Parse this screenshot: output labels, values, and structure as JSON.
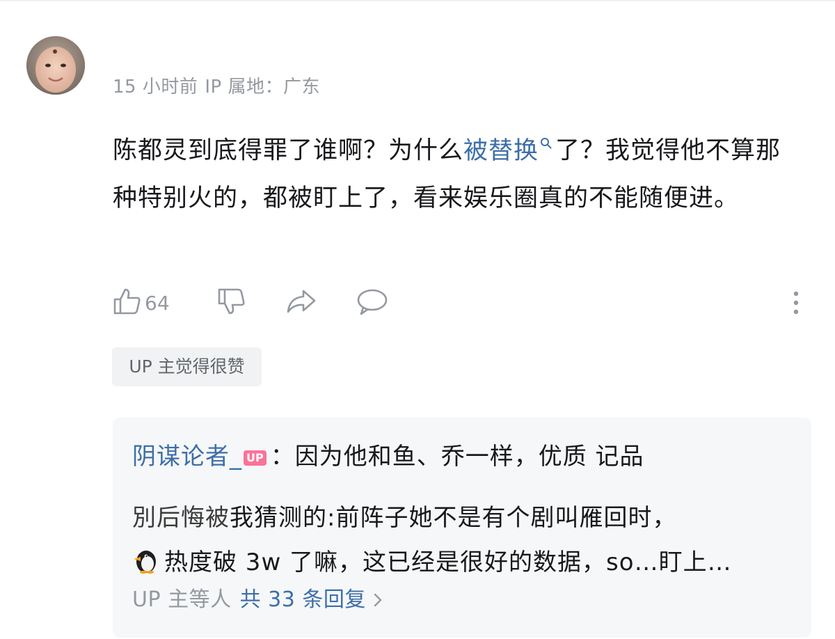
{
  "comment": {
    "time": "15 小时前",
    "ip_location": "IP 属地：广东",
    "text_before": "陈都灵到底得罪了谁啊？为什么",
    "keyword": "被替换",
    "text_after": "了？我觉得他不算那种特别火的，都被盯上了，看来娱乐圈真的不能随便进。",
    "like_count": "64",
    "up_liked_tag": "UP 主觉得很赞"
  },
  "reply_preview": {
    "author": "阴谋论者_",
    "author_badge": "UP",
    "text": "：因为他和鱼、乔一样，优质 记品",
    "line2_garbled": "別后悔被",
    "line2_rest": "我猜测的:前阵子她不是有个剧叫雁回时，",
    "line3_rest": "热度破 3w 了嘛，这已经是很好的数据，so…盯上…",
    "footer_who": "UP 主等人",
    "footer_count": "共 33 条回复"
  },
  "colors": {
    "link_blue": "#3d6fa8",
    "meta_gray": "#9499a0",
    "up_pink": "#fb7299",
    "reply_bg": "#f6f7f8",
    "tag_bg": "#f1f2f3"
  },
  "icons": {
    "like": "thumbs-up-icon",
    "dislike": "thumbs-down-icon",
    "share": "share-arrow-icon",
    "reply": "chat-bubble-icon",
    "more": "more-vertical-icon",
    "search": "search-icon",
    "penguin": "penguin-emoji-icon",
    "chevron": "chevron-right-icon"
  }
}
